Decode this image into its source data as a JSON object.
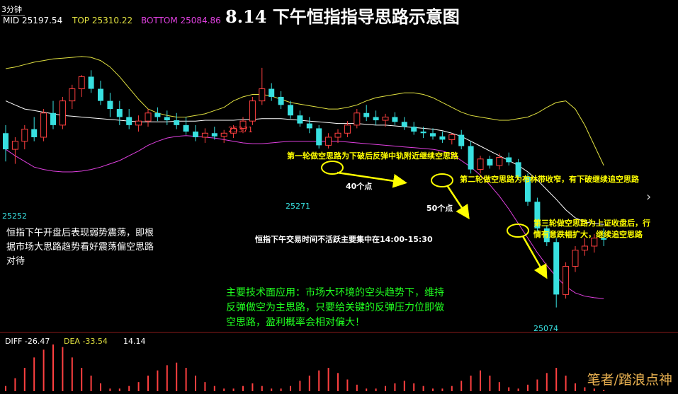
{
  "window": {
    "period": "3分钟",
    "title": "8.14   下午恒指指导思路示意图"
  },
  "indicators": {
    "mid": "MID 25197.54",
    "top": "TOP 25310.22",
    "bottom": "BOTTOM 25084.86",
    "diff": "DIFF -26.47",
    "dea": "DEA -33.54",
    "macd": "14.14"
  },
  "colors": {
    "up_candle": "#ff4040",
    "down_candle": "#38e0e0",
    "mid_line": "#ffffff",
    "top_line": "#e0e040",
    "bottom_line": "#e040e0",
    "annotation": "#ffff00",
    "green_note": "#20ff20",
    "circle": "#ffff00"
  },
  "price_labels": {
    "low_left": "25252",
    "high_mid": "25371",
    "low_mid": "25271",
    "low_right": "25074"
  },
  "annotations": {
    "round1": "第一轮做空思路为下破后反弹中轨附近继续空思路",
    "round2": "第二轮做空思路为布林带收窄，有下破继续追空思路",
    "round3_line1": "第三轮做空思路为上证收盘后，行",
    "round3_line2": "情有意跌幅扩大，继续追空思路",
    "pts40": "40个点",
    "pts50": "50个点",
    "session": "恒指下午交易时间不活跃主要集中在14:00-15:30"
  },
  "notes": {
    "left_line1": "恒指下午开盘后表现弱势震荡，即根",
    "left_line2": "据市场大思路趋势看好震荡偏空思路",
    "left_line3": "对待",
    "green_line1": "主要技术面应用：市场大环境的空头趋势下，维持",
    "green_line2": "反弹做空为主思路，只要给关键的反弹压力位即做",
    "green_line3": "空思路，盈利概率会相对偏大！"
  },
  "watermark": "笔者/踏浪点神",
  "nav": {
    "next_glyph": "›"
  },
  "chart_data": {
    "type": "candlestick",
    "ylim": [
      25050,
      25420
    ],
    "candles": [
      [
        25290,
        25300,
        25255,
        25270
      ],
      [
        25270,
        25285,
        25252,
        25280
      ],
      [
        25280,
        25300,
        25270,
        25295
      ],
      [
        25295,
        25310,
        25280,
        25285
      ],
      [
        25285,
        25320,
        25280,
        25315
      ],
      [
        25315,
        25330,
        25295,
        25300
      ],
      [
        25300,
        25335,
        25295,
        25330
      ],
      [
        25330,
        25350,
        25320,
        25345
      ],
      [
        25345,
        25362,
        25335,
        25360
      ],
      [
        25360,
        25368,
        25340,
        25345
      ],
      [
        25345,
        25355,
        25325,
        25330
      ],
      [
        25330,
        25340,
        25310,
        25320
      ],
      [
        25320,
        25330,
        25300,
        25310
      ],
      [
        25310,
        25320,
        25295,
        25300
      ],
      [
        25300,
        25312,
        25292,
        25305
      ],
      [
        25305,
        25320,
        25298,
        25315
      ],
      [
        25315,
        25322,
        25305,
        25310
      ],
      [
        25310,
        25318,
        25300,
        25306
      ],
      [
        25306,
        25315,
        25295,
        25300
      ],
      [
        25300,
        25310,
        25288,
        25292
      ],
      [
        25292,
        25300,
        25280,
        25285
      ],
      [
        25285,
        25296,
        25278,
        25290
      ],
      [
        25290,
        25298,
        25282,
        25286
      ],
      [
        25286,
        25294,
        25278,
        25290
      ],
      [
        25290,
        25300,
        25284,
        25296
      ],
      [
        25296,
        25310,
        25290,
        25305
      ],
      [
        25305,
        25335,
        25300,
        25330
      ],
      [
        25330,
        25371,
        25325,
        25345
      ],
      [
        25345,
        25352,
        25330,
        25335
      ],
      [
        25335,
        25342,
        25320,
        25325
      ],
      [
        25325,
        25330,
        25308,
        25312
      ],
      [
        25312,
        25318,
        25298,
        25302
      ],
      [
        25302,
        25310,
        25290,
        25296
      ],
      [
        25296,
        25300,
        25271,
        25275
      ],
      [
        25275,
        25290,
        25271,
        25285
      ],
      [
        25285,
        25295,
        25278,
        25290
      ],
      [
        25290,
        25305,
        25285,
        25300
      ],
      [
        25300,
        25320,
        25296,
        25315
      ],
      [
        25315,
        25325,
        25305,
        25310
      ],
      [
        25310,
        25318,
        25300,
        25306
      ],
      [
        25306,
        25314,
        25298,
        25310
      ],
      [
        25310,
        25316,
        25300,
        25304
      ],
      [
        25304,
        25310,
        25294,
        25298
      ],
      [
        25298,
        25304,
        25288,
        25292
      ],
      [
        25292,
        25298,
        25284,
        25290
      ],
      [
        25290,
        25296,
        25282,
        25286
      ],
      [
        25286,
        25292,
        25278,
        25282
      ],
      [
        25282,
        25290,
        25276,
        25288
      ],
      [
        25288,
        25294,
        25270,
        25274
      ],
      [
        25274,
        25280,
        25240,
        25245
      ],
      [
        25245,
        25262,
        25240,
        25258
      ],
      [
        25258,
        25262,
        25246,
        25250
      ],
      [
        25250,
        25265,
        25245,
        25260
      ],
      [
        25260,
        25266,
        25250,
        25254
      ],
      [
        25254,
        25258,
        25232,
        25236
      ],
      [
        25236,
        25240,
        25200,
        25205
      ],
      [
        25205,
        25210,
        25168,
        25172
      ],
      [
        25172,
        25176,
        25150,
        25155
      ],
      [
        25155,
        25160,
        25074,
        25090
      ],
      [
        25090,
        25130,
        25085,
        25125
      ],
      [
        25125,
        25150,
        25118,
        25145
      ],
      [
        25145,
        25160,
        25138,
        25150
      ],
      [
        25150,
        25165,
        25142,
        25160
      ],
      [
        25160,
        25172,
        25150,
        25158
      ]
    ],
    "top_band": [
      25370,
      25372,
      25375,
      25378,
      25380,
      25382,
      25383,
      25384,
      25385,
      25384,
      25380,
      25372,
      25360,
      25346,
      25332,
      25320,
      25315,
      25312,
      25310,
      25310,
      25312,
      25314,
      25318,
      25322,
      25330,
      25335,
      25338,
      25338,
      25336,
      25332,
      25328,
      25326,
      25324,
      25322,
      25320,
      25320,
      25322,
      25325,
      25330,
      25334,
      25336,
      25338,
      25340,
      25340,
      25338,
      25334,
      25328,
      25322,
      25316,
      25312,
      25310,
      25308,
      25306,
      25306,
      25308,
      25310,
      25315,
      25322,
      25328,
      25330,
      25320,
      25300,
      25275,
      25250
    ],
    "mid_band": [
      25330,
      25325,
      25320,
      25318,
      25316,
      25314,
      25312,
      25311,
      25310,
      25309,
      25308,
      25307,
      25306,
      25305,
      25304,
      25304,
      25304,
      25304,
      25305,
      25305,
      25305,
      25306,
      25306,
      25306,
      25306,
      25307,
      25307,
      25308,
      25308,
      25308,
      25307,
      25306,
      25305,
      25304,
      25303,
      25302,
      25302,
      25302,
      25301,
      25300,
      25300,
      25299,
      25298,
      25297,
      25296,
      25295,
      25293,
      25290,
      25286,
      25280,
      25274,
      25268,
      25262,
      25256,
      25250,
      25242,
      25232,
      25220,
      25208,
      25195,
      25185,
      25180,
      25178,
      25177
    ],
    "bottom_band": [
      25270,
      25262,
      25255,
      25248,
      25245,
      25243,
      25242,
      25242,
      25243,
      25245,
      25248,
      25252,
      25256,
      25262,
      25268,
      25275,
      25280,
      25284,
      25286,
      25287,
      25286,
      25285,
      25284,
      25282,
      25280,
      25278,
      25277,
      25277,
      25278,
      25279,
      25280,
      25280,
      25280,
      25280,
      25280,
      25280,
      25279,
      25278,
      25277,
      25276,
      25275,
      25274,
      25273,
      25272,
      25271,
      25270,
      25268,
      25264,
      25256,
      25248,
      25238,
      25226,
      25212,
      25196,
      25178,
      25160,
      25142,
      25126,
      25112,
      25100,
      25092,
      25088,
      25086,
      25085
    ],
    "macd_bars": [
      0.2,
      0.5,
      0.9,
      1.3,
      1.6,
      1.8,
      1.7,
      1.3,
      0.9,
      0.6,
      0.3,
      0.1,
      0.1,
      0.2,
      0.35,
      0.6,
      0.8,
      1.0,
      1.1,
      0.9,
      0.6,
      0.35,
      0.2,
      0.1,
      0.1,
      0.2,
      0.3,
      0.2,
      0.1,
      0.1,
      0.2,
      0.4,
      0.6,
      0.8,
      0.9,
      0.7,
      0.45,
      0.25,
      0.1,
      0.1,
      0.2,
      0.3,
      0.4,
      0.3,
      0.2,
      0.1,
      0.1,
      0.2,
      0.4,
      0.6,
      0.8,
      0.6,
      0.35,
      0.15,
      0.1,
      0.25,
      0.45,
      0.7,
      0.9,
      0.6,
      0.3,
      0.15,
      0.1,
      0.05
    ]
  }
}
